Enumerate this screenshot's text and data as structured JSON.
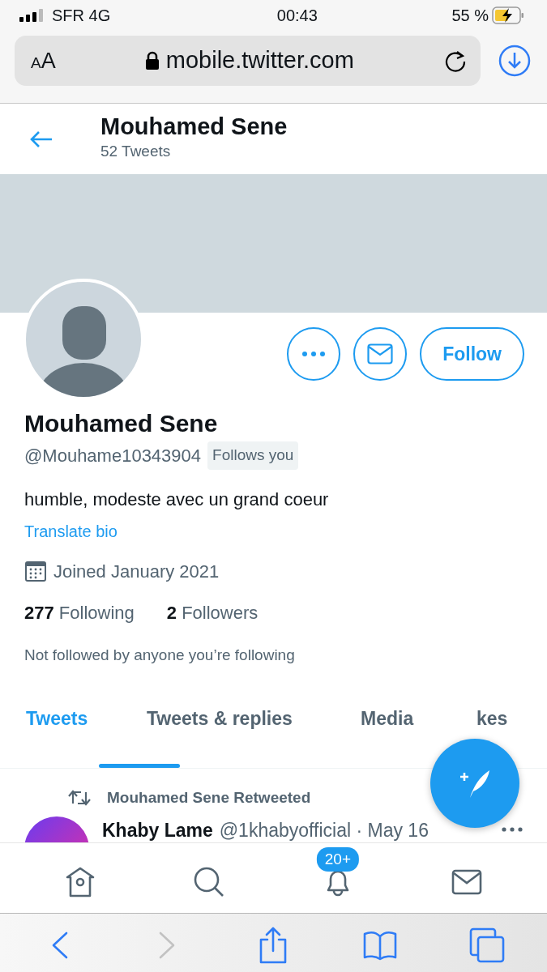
{
  "status_bar": {
    "carrier": "SFR 4G",
    "time": "00:43",
    "battery": "55 %",
    "charging": true
  },
  "browser": {
    "text_size_button": "AA",
    "url": "mobile.twitter.com"
  },
  "header": {
    "title": "Mouhamed Sene",
    "subtitle": "52 Tweets"
  },
  "profile": {
    "name": "Mouhamed Sene",
    "handle": "@Mouhame10343904",
    "follows_you": "Follows you",
    "bio": "humble, modeste avec un grand coeur",
    "translate": "Translate bio",
    "joined": "Joined January 2021",
    "stats": [
      "**277** Following",
      "**2** Followers"
    ],
    "not_followed": "Not followed by anyone you’re following",
    "follow_button": "Follow"
  },
  "tabs": [
    {
      "label": "Tweets",
      "selected": true
    },
    {
      "label": "Tweets & replies",
      "selected": false
    },
    {
      "label": "Media",
      "selected": false
    },
    {
      "label": "kes",
      "selected": false
    }
  ],
  "tweets": [
    {
      "retweeted_by": "Mouhamed Sene Retweeted",
      "author": "Khaby Lame",
      "handle_date": "@1khabyofficial · May 16"
    }
  ],
  "nav": [
    {
      "kind": "home"
    },
    {
      "kind": "search"
    },
    {
      "kind": "notifications",
      "badge": "20+"
    },
    {
      "kind": "messages"
    }
  ],
  "browser_toolbar": [
    {
      "kind": "back",
      "disabled": false
    },
    {
      "kind": "forward",
      "disabled": true
    },
    {
      "kind": "share",
      "disabled": false
    },
    {
      "kind": "bookmarks",
      "disabled": false
    },
    {
      "kind": "tabs",
      "disabled": false
    }
  ]
}
